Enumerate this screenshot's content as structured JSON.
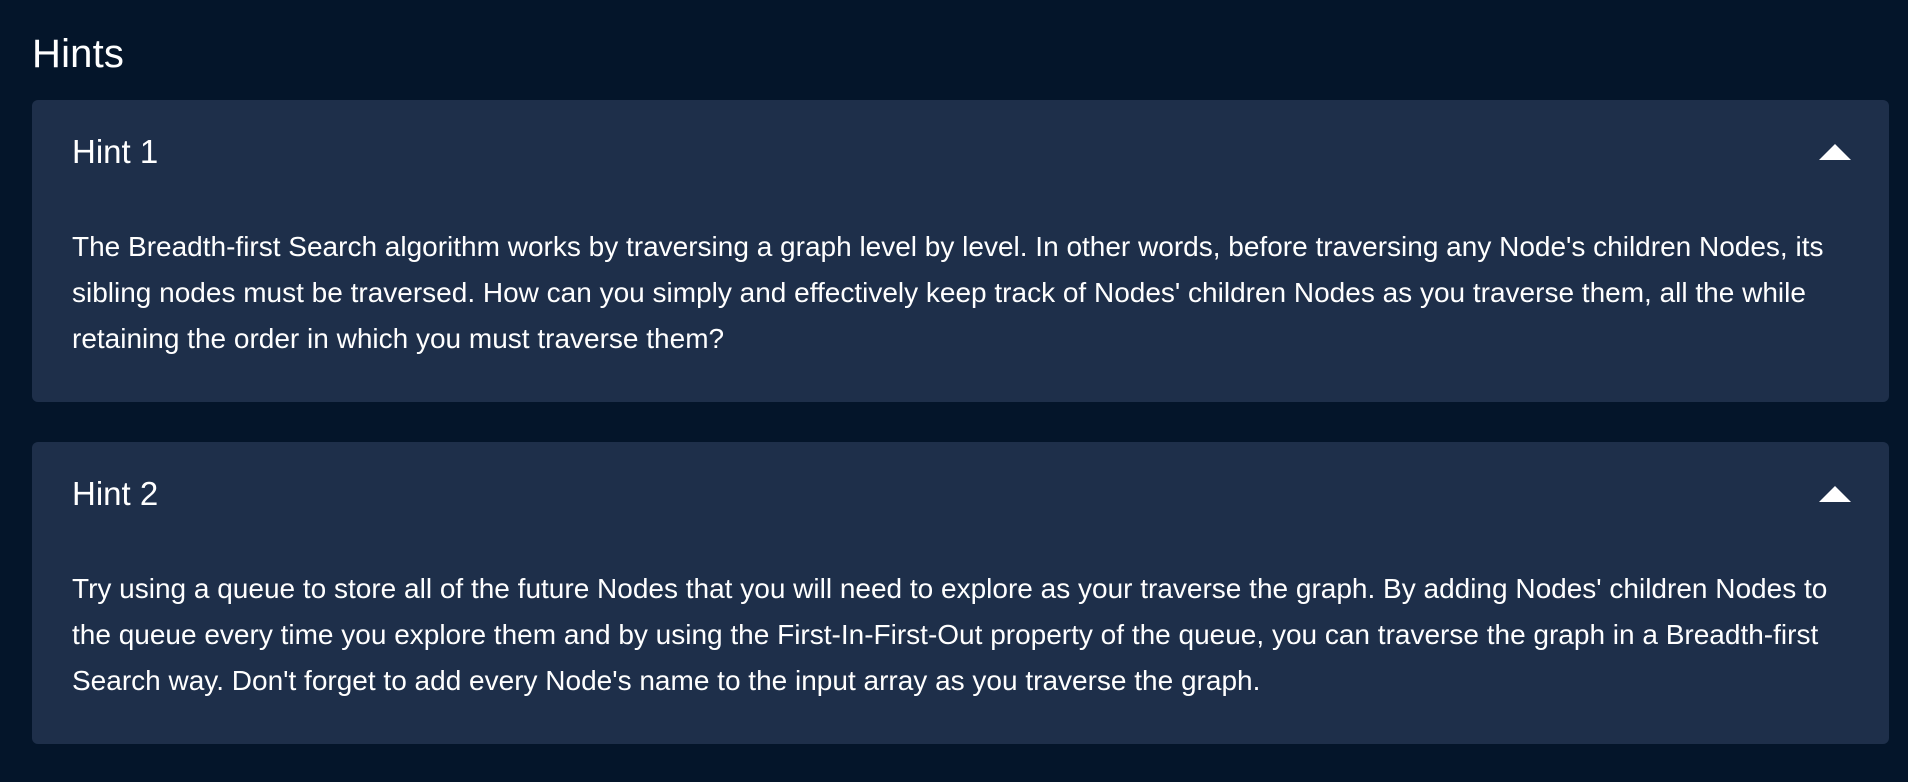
{
  "section": {
    "title": "Hints"
  },
  "hints": [
    {
      "title": "Hint 1",
      "toggle_icon": "caret-up-icon",
      "body": "The Breadth-first Search algorithm works by traversing a graph level by level. In other words, before traversing any Node's children Nodes, its sibling nodes must be traversed. How can you simply and effectively keep track of Nodes' children Nodes as you traverse them, all the while retaining the order in which you must traverse them?"
    },
    {
      "title": "Hint 2",
      "toggle_icon": "caret-up-icon",
      "body": "Try using a queue to store all of the future Nodes that you will need to explore as your traverse the graph. By adding Nodes' children Nodes to the queue every time you explore them and by using the First-In-First-Out property of the queue, you can traverse the graph in a Breadth-first Search way. Don't forget to add every Node's name to the input array as you traverse the graph."
    }
  ],
  "colors": {
    "page_background": "#04152a",
    "card_background": "#1e2f4a",
    "text": "#ffffff"
  }
}
